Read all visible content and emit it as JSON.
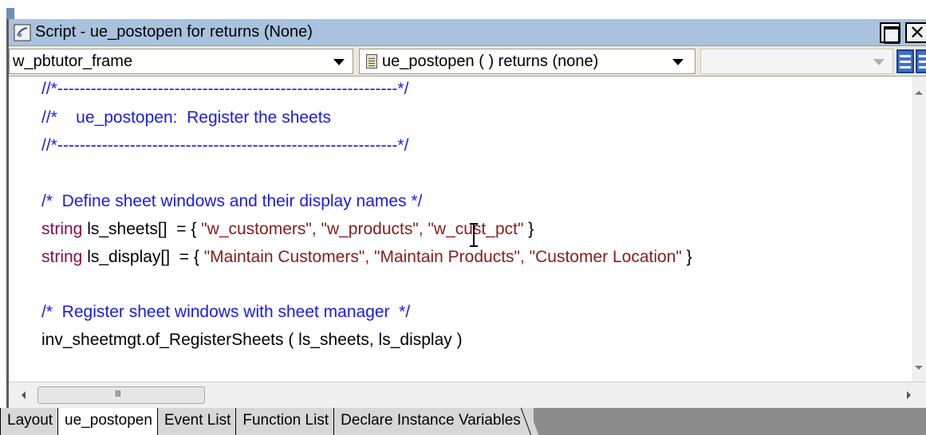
{
  "window": {
    "title": "Script - ue_postopen for  returns (None)",
    "icon": "script-icon",
    "maximize_icon": "maximize-icon",
    "close_icon": "close-icon",
    "close_glyph": "✕"
  },
  "toolbar": {
    "object_dropdown": {
      "value": "w_pbtutor_frame"
    },
    "event_dropdown": {
      "value": "ue_postopen ( ) returns (none)",
      "icon": "script-icon"
    },
    "ancestor_dropdown": {
      "value": ""
    },
    "layout_icons": [
      "layout-icon",
      "layout-icon"
    ]
  },
  "code": {
    "lines": [
      {
        "kind": "comment",
        "text": "//*-------------------------------------------------------------*/"
      },
      {
        "kind": "comment",
        "text": "//*    ue_postopen:  Register the sheets"
      },
      {
        "kind": "comment",
        "text": "//*-------------------------------------------------------------*/"
      },
      {
        "kind": "comment",
        "text": "/*  Define sheet windows and their display names */"
      },
      {
        "kind": "declaration",
        "keyword": "string",
        "plain": " ls_sheets[]  = { ",
        "strings": "\"w_customers\", \"w_products\", \"w_cust_pct\"",
        "tail": " }"
      },
      {
        "kind": "declaration",
        "keyword": "string",
        "plain": " ls_display[]  = { ",
        "strings": "\"Maintain Customers\", \"Maintain Products\", \"Customer Location\"",
        "tail": " }"
      },
      {
        "kind": "comment",
        "text": "/*  Register sheet windows with sheet manager  */"
      },
      {
        "kind": "plain",
        "text": "inv_sheetmgt.of_RegisterSheets ( ls_sheets, ls_display )"
      }
    ]
  },
  "tabs": [
    {
      "label": "Layout",
      "active": false
    },
    {
      "label": "ue_postopen",
      "active": true
    },
    {
      "label": "Event List",
      "active": false
    },
    {
      "label": "Function List",
      "active": false
    },
    {
      "label": "Declare Instance Variables",
      "active": false
    }
  ],
  "colors": {
    "comment": "#1a1af0",
    "keyword": "#8b0a50",
    "string": "#8b1a1a",
    "titlebar": "#a9c2de"
  }
}
